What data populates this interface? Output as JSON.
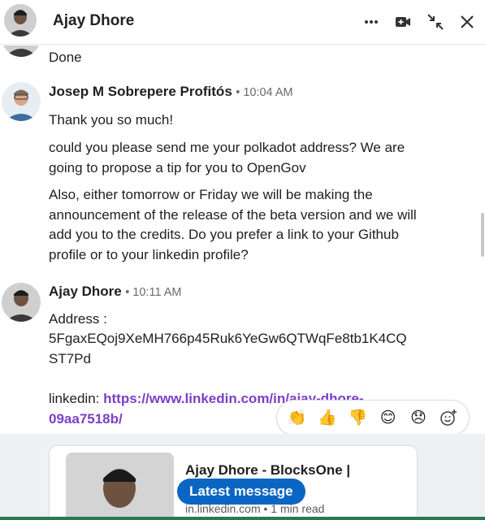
{
  "header": {
    "title": "Ajay Dhore",
    "icons": [
      "more-options-icon",
      "video-call-icon",
      "collapse-icon",
      "close-icon"
    ]
  },
  "messages": [
    {
      "text": "Done"
    },
    {
      "sender": "Josep M Sobrepere Profitós",
      "time": "• 10:04 AM",
      "paragraphs": [
        "Thank you so much!",
        "could you please send me your polkadot address? We are going to propose a tip for you to OpenGov",
        "Also, either tomorrow or Friday we will be making the announcement of the release of the beta version and we will add you to the credits. Do you prefer a link to your Github profile or to your linkedin profile?"
      ]
    },
    {
      "sender": "Ajay Dhore",
      "time": "• 10:11 AM",
      "address_label": "Address :",
      "address_line1": "5FgaxEQoj9XeMH766p45Ruk6YeGw6QTWqFe8tb1K4CQ",
      "address_line2": "ST7Pd",
      "linkedin_label": "linkedin:",
      "link_line1": "https://www.linkedin.com/in/ajay-dhore-",
      "link_line2": "09aa7518b/"
    }
  ],
  "reactions": [
    "👏",
    "👍",
    "👎",
    "😊",
    "😞",
    "add-reaction-icon"
  ],
  "preview": {
    "title": "Ajay Dhore - BlocksOne |",
    "source": "in.linkedin.com • 1 min read"
  },
  "latest_button": "Latest message",
  "colors": {
    "accent": "#0a66c2",
    "link": "#7b3fc6"
  }
}
